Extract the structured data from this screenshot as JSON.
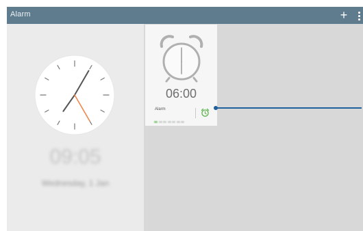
{
  "action_bar": {
    "title": "Alarm",
    "add_label": "+"
  },
  "world_clock": {
    "digital_time": "09:05",
    "date": "Wednesday, 1 Jan",
    "hour_hand_angle_deg": 215,
    "minute_hand_angle_deg": 30,
    "second_hand_angle_deg": 150
  },
  "alarm_card": {
    "time": "06:00",
    "label": "Alarm",
    "days_active": [
      true,
      false,
      false,
      false,
      false,
      false,
      false
    ],
    "state": "on"
  },
  "colors": {
    "action_bar": "#5f7b8e",
    "second_hand": "#f0874c",
    "alarm_on": "#5ab34a",
    "callout": "#1f5f9c"
  }
}
